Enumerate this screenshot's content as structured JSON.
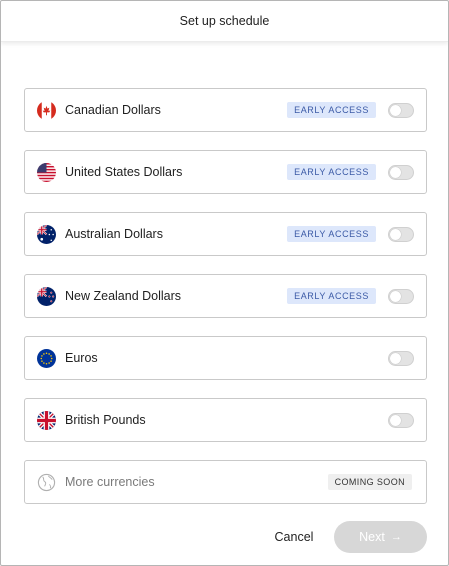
{
  "header": {
    "title": "Set up schedule"
  },
  "currencies": [
    {
      "label": "Canadian Dollars",
      "badge": "EARLY ACCESS",
      "flag": "canada-flag-icon",
      "enabled": false
    },
    {
      "label": "United States Dollars",
      "badge": "EARLY ACCESS",
      "flag": "usa-flag-icon",
      "enabled": false
    },
    {
      "label": "Australian Dollars",
      "badge": "EARLY ACCESS",
      "flag": "australia-flag-icon",
      "enabled": false
    },
    {
      "label": "New Zealand Dollars",
      "badge": "EARLY ACCESS",
      "flag": "new-zealand-flag-icon",
      "enabled": false
    },
    {
      "label": "Euros",
      "flag": "eu-flag-icon",
      "enabled": false
    },
    {
      "label": "British Pounds",
      "flag": "uk-flag-icon",
      "enabled": false
    }
  ],
  "more": {
    "label": "More currencies",
    "badge": "COMING SOON",
    "icon": "globe-icon"
  },
  "footer": {
    "cancel_label": "Cancel",
    "next_label": "Next",
    "next_icon": "→"
  },
  "colors": {
    "badge_text": "#3b5aa6",
    "badge_bg": "#dde7fb",
    "next_disabled_bg": "#d7d7d7",
    "border": "#c9c9c9"
  }
}
